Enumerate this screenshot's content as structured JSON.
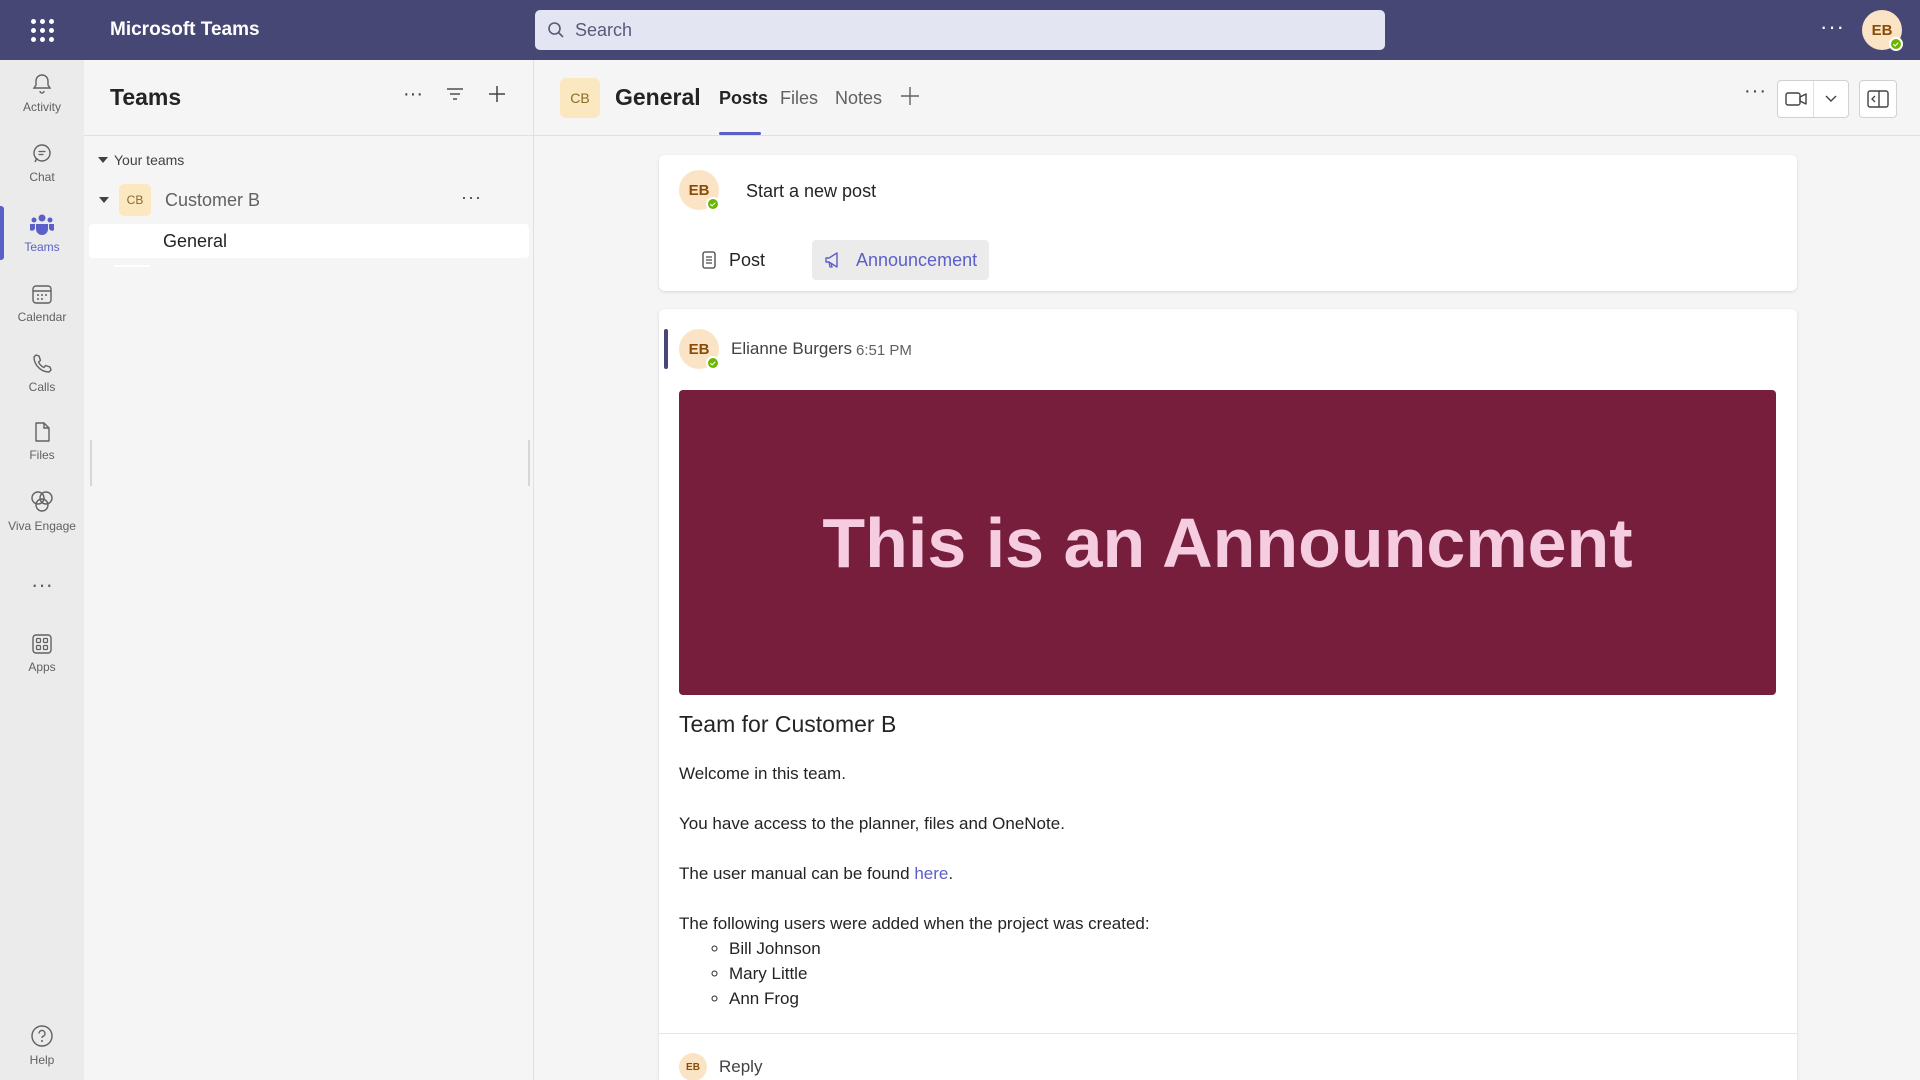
{
  "app": {
    "title": "Microsoft Teams",
    "user_initials": "EB"
  },
  "search": {
    "placeholder": "Search"
  },
  "rail": {
    "items": [
      {
        "label": "Activity",
        "icon": "bell-icon"
      },
      {
        "label": "Chat",
        "icon": "chat-icon"
      },
      {
        "label": "Teams",
        "icon": "teams-icon"
      },
      {
        "label": "Calendar",
        "icon": "calendar-icon"
      },
      {
        "label": "Calls",
        "icon": "phone-icon"
      },
      {
        "label": "Files",
        "icon": "file-icon"
      },
      {
        "label": "Viva Engage",
        "icon": "viva-engage-icon"
      },
      {
        "label": "Apps",
        "icon": "apps-icon"
      },
      {
        "label": "Help",
        "icon": "help-icon"
      }
    ],
    "active": "Teams"
  },
  "teams_panel": {
    "title": "Teams",
    "section_label": "Your teams",
    "team": {
      "initials": "CB",
      "name": "Customer B"
    },
    "channel": "General"
  },
  "channel": {
    "initials": "CB",
    "name": "General",
    "tabs": [
      "Posts",
      "Files",
      "Notes"
    ],
    "active_tab": "Posts"
  },
  "new_post": {
    "initials": "EB",
    "prompt": "Start a new post",
    "post_label": "Post",
    "announcement_label": "Announcement"
  },
  "message": {
    "initials": "EB",
    "author": "Elianne Burgers",
    "time": "6:51 PM",
    "banner_text": "This is an Announcment",
    "subject": "Team for Customer B",
    "line1": "Welcome in this team.",
    "line2": "You have access to the planner, files and OneNote.",
    "line3_prefix": "The user manual can be found ",
    "line3_link": "here",
    "line3_suffix": ".",
    "line4": "The following users were added when the project was created:",
    "users": [
      "Bill Johnson",
      "Mary Little",
      "Ann Frog"
    ],
    "reply_initials": "EB",
    "reply_label": "Reply"
  },
  "colors": {
    "topbar": "#464775",
    "accent": "#5b5fc7",
    "banner": "#761e3c",
    "banner_text": "#f6cde0",
    "presence": "#6bb700"
  }
}
